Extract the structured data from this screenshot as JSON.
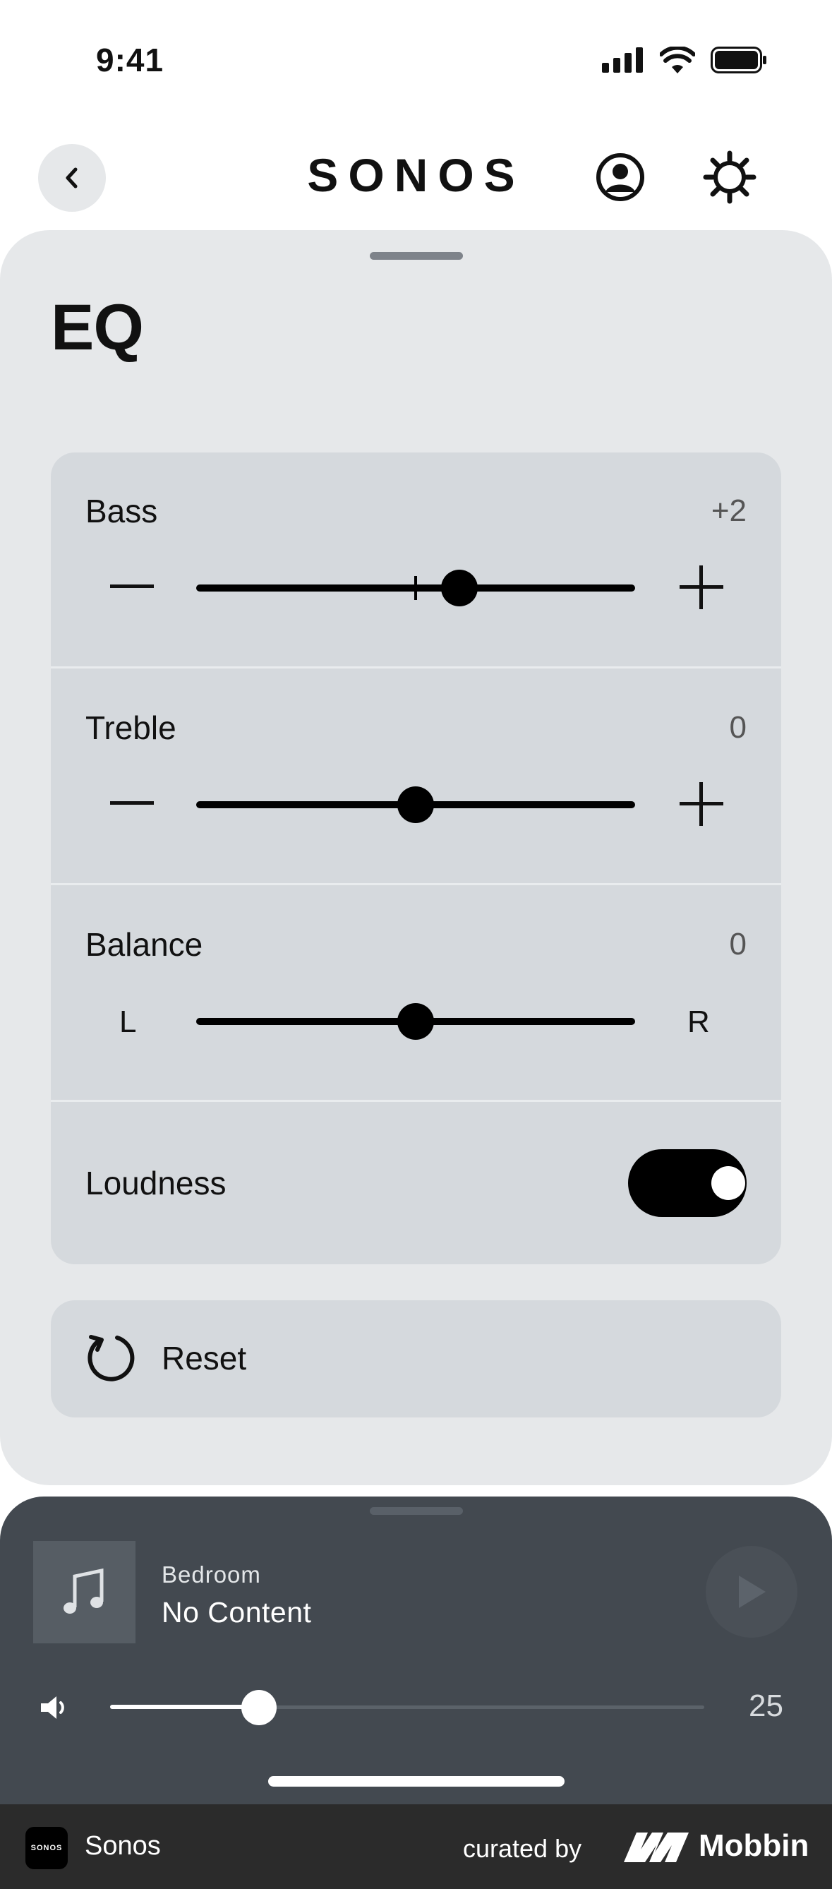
{
  "status_bar": {
    "time": "9:41"
  },
  "header": {
    "brand": "SONOS",
    "back_icon": "chevron-left-icon",
    "account_icon": "account-icon",
    "settings_icon": "gear-icon"
  },
  "page": {
    "title": "EQ"
  },
  "eq": {
    "bass": {
      "label": "Bass",
      "value": "+2",
      "level": 2,
      "min": -10,
      "max": 10,
      "decrease_icon": "minus-icon",
      "increase_icon": "plus-icon"
    },
    "treble": {
      "label": "Treble",
      "value": "0",
      "level": 0,
      "min": -10,
      "max": 10,
      "decrease_icon": "minus-icon",
      "increase_icon": "plus-icon"
    },
    "balance": {
      "label": "Balance",
      "value": "0",
      "level": 0,
      "left_label": "L",
      "right_label": "R"
    },
    "loudness": {
      "label": "Loudness",
      "on": true
    }
  },
  "reset": {
    "label": "Reset",
    "icon": "reset-icon"
  },
  "player": {
    "room": "Bedroom",
    "title": "No Content",
    "volume": 25,
    "volume_display": "25",
    "art_icon": "music-note-icon",
    "play_icon": "play-icon",
    "volume_icon": "speaker-icon"
  },
  "footer": {
    "app_name": "Sonos",
    "logo_text": "SONOS",
    "curated_by": "curated by",
    "brand": "Mobbin"
  },
  "colors": {
    "sheet": "#e6e8ea",
    "card": "#d5d9dd",
    "player": "#434950",
    "footer": "#2b2b2b"
  }
}
